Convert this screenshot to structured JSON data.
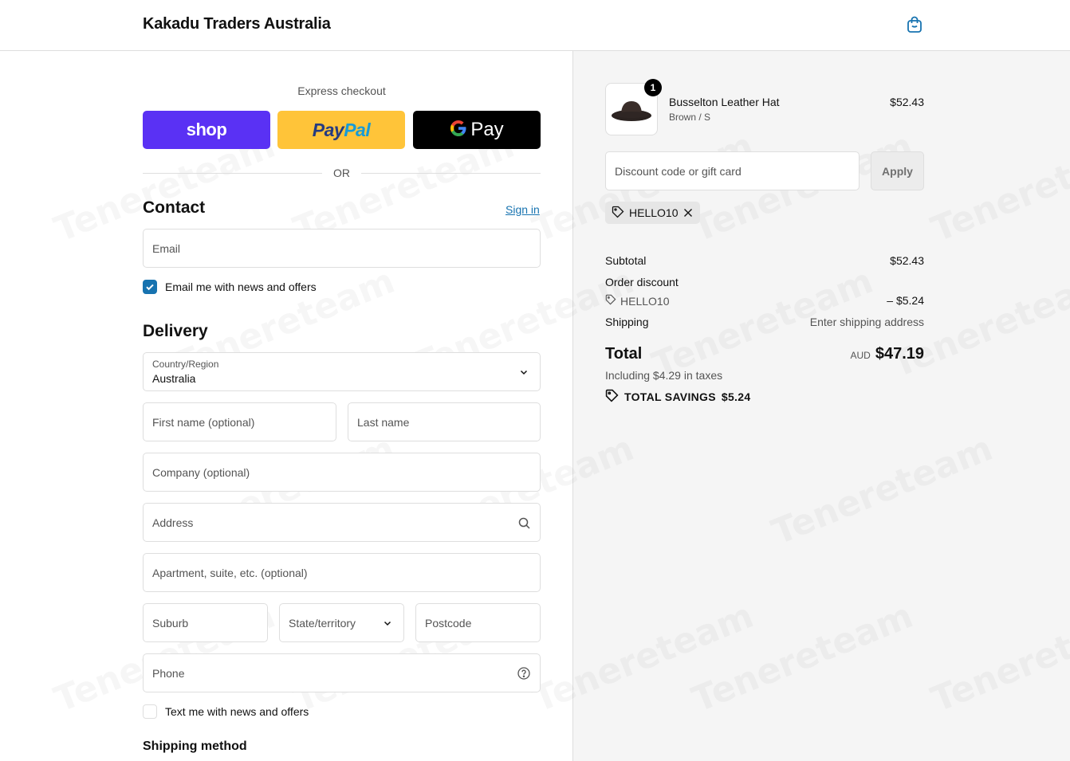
{
  "header": {
    "shop_name": "Kakadu Traders Australia",
    "cart_icon": "shopping-bag-icon"
  },
  "express": {
    "label": "Express checkout",
    "shop_pay_label": "shop",
    "paypal_label_part1": "Pay",
    "paypal_label_part2": "Pal",
    "gpay_label": "Pay"
  },
  "divider": {
    "or_label": "OR"
  },
  "contact": {
    "title": "Contact",
    "sign_in": "Sign in",
    "email_placeholder": "Email",
    "news_checkbox_label": "Email me with news and offers",
    "news_checked": true
  },
  "delivery": {
    "title": "Delivery",
    "country_label": "Country/Region",
    "country_value": "Australia",
    "first_name_placeholder": "First name (optional)",
    "last_name_placeholder": "Last name",
    "company_placeholder": "Company (optional)",
    "address_placeholder": "Address",
    "apartment_placeholder": "Apartment, suite, etc. (optional)",
    "suburb_placeholder": "Suburb",
    "state_placeholder": "State/territory",
    "postcode_placeholder": "Postcode",
    "phone_placeholder": "Phone",
    "sms_checkbox_label": "Text me with news and offers",
    "sms_checked": false
  },
  "shipping_method": {
    "title": "Shipping method"
  },
  "summary": {
    "item": {
      "quantity": "1",
      "name": "Busselton Leather Hat",
      "variant": "Brown / S",
      "price": "$52.43"
    },
    "discount_placeholder": "Discount code or gift card",
    "apply_label": "Apply",
    "applied_code": "HELLO10",
    "subtotal_label": "Subtotal",
    "subtotal_value": "$52.43",
    "order_discount_label": "Order discount",
    "order_discount_code": "HELLO10",
    "order_discount_value": "– $5.24",
    "shipping_label": "Shipping",
    "shipping_value": "Enter shipping address",
    "total_label": "Total",
    "total_currency": "AUD",
    "total_value": "$47.19",
    "taxes_note": "Including $4.29 in taxes",
    "total_savings_label": "TOTAL SAVINGS",
    "total_savings_value": "$5.24"
  },
  "colors": {
    "accent": "#1773b0",
    "shop_pay": "#5a31f4",
    "paypal": "#ffc439",
    "summary_bg": "#f5f5f5"
  },
  "watermark_text": "Tenereteam"
}
